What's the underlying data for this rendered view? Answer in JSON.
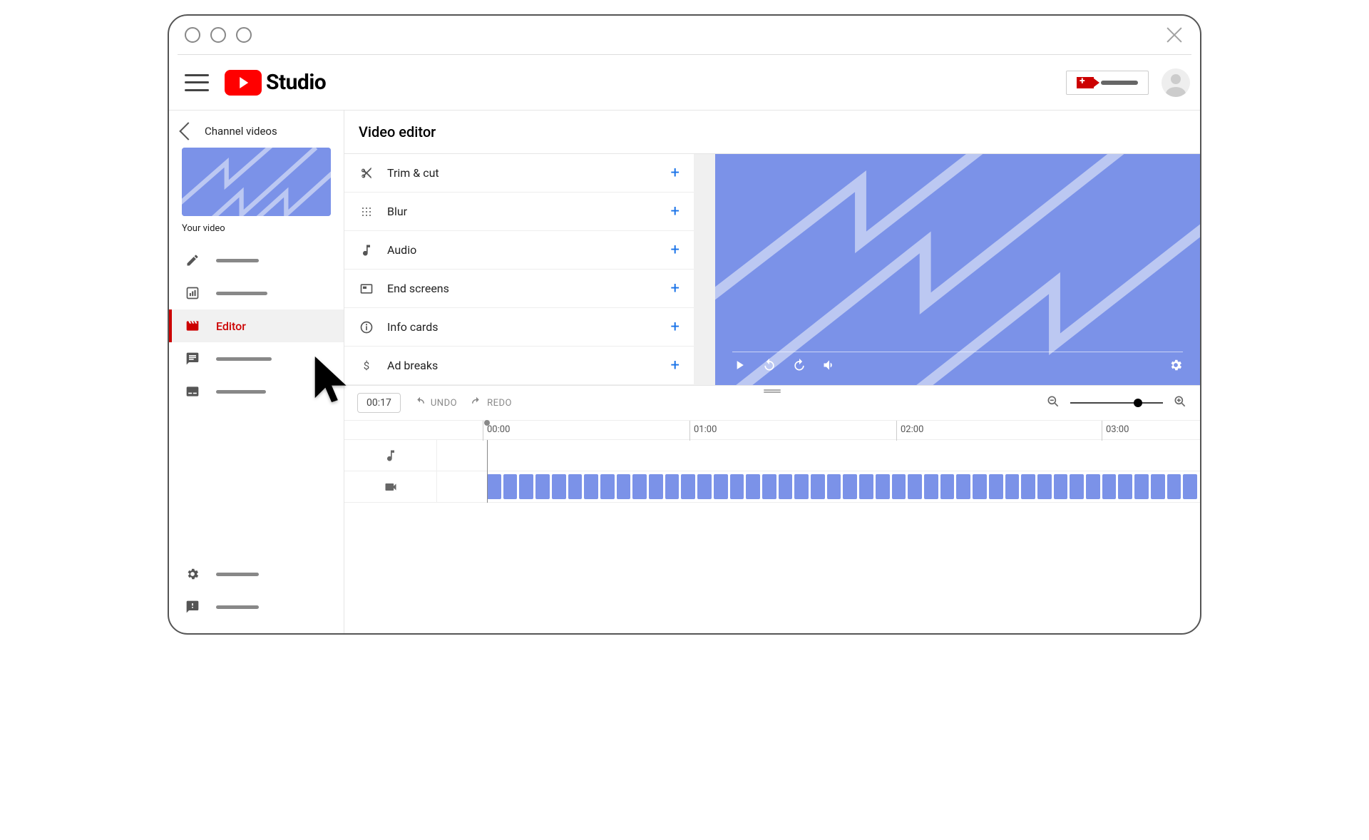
{
  "brand": {
    "name": "Studio"
  },
  "sidebar": {
    "back_label": "Channel videos",
    "your_video_label": "Your video",
    "items": [
      {
        "icon": "pencil",
        "label": ""
      },
      {
        "icon": "analytics",
        "label": ""
      },
      {
        "icon": "editor",
        "label": "Editor",
        "active": true
      },
      {
        "icon": "comments",
        "label": ""
      },
      {
        "icon": "subtitles",
        "label": ""
      }
    ],
    "bottom": [
      {
        "icon": "settings",
        "label": ""
      },
      {
        "icon": "feedback",
        "label": ""
      }
    ]
  },
  "page": {
    "title": "Video editor"
  },
  "tools": [
    {
      "icon": "scissors",
      "label": "Trim & cut"
    },
    {
      "icon": "blur",
      "label": "Blur"
    },
    {
      "icon": "music",
      "label": "Audio"
    },
    {
      "icon": "endscreen",
      "label": "End screens"
    },
    {
      "icon": "info",
      "label": "Info cards"
    },
    {
      "icon": "dollar",
      "label": "Ad breaks"
    }
  ],
  "player": {
    "controls": [
      "play",
      "replay10",
      "forward10",
      "volume"
    ],
    "settings_icon": "gear"
  },
  "timeline": {
    "current_time": "00:17",
    "undo_label": "UNDO",
    "redo_label": "REDO",
    "ruler": [
      "00:00",
      "01:00",
      "02:00",
      "03:00"
    ],
    "zoom_percent": 75,
    "clip_count": 44
  }
}
